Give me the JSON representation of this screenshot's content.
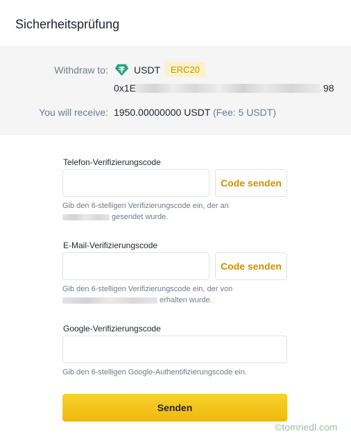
{
  "header": {
    "title": "Sicherheitsprüfung"
  },
  "summary": {
    "withdraw_label": "Withdraw to:",
    "coin": "USDT",
    "network": "ERC20",
    "address_prefix": "0x1E",
    "address_suffix": "98",
    "receive_label": "You will receive:",
    "amount": "1950.00000000 USDT",
    "fee": "(Fee: 5 USDT)",
    "coin_icon": "tether-icon"
  },
  "form": {
    "phone": {
      "label": "Telefon-Verifizierungscode",
      "send_label": "Code senden",
      "hint_a": "Gib den 6-stelligen Verifizierungscode ein, der an",
      "hint_b": "gesendet wurde."
    },
    "email": {
      "label": "E-Mail-Verifizierungscode",
      "send_label": "Code senden",
      "hint_a": "Gib den 6-stelligen Verifizierungscode ein, der von",
      "hint_b": "erhalten wurde."
    },
    "google": {
      "label": "Google-Verifizierungscode",
      "hint": "Gib den 6-stelligen Google-Authentifizierungscode ein."
    },
    "submit_label": "Senden"
  },
  "watermark": {
    "text": "©tomriedl.com"
  },
  "colors": {
    "accent": "#f0b90b",
    "accent_text": "#c99400",
    "badge_bg": "#fdf1c8",
    "tether": "#26a17b"
  }
}
